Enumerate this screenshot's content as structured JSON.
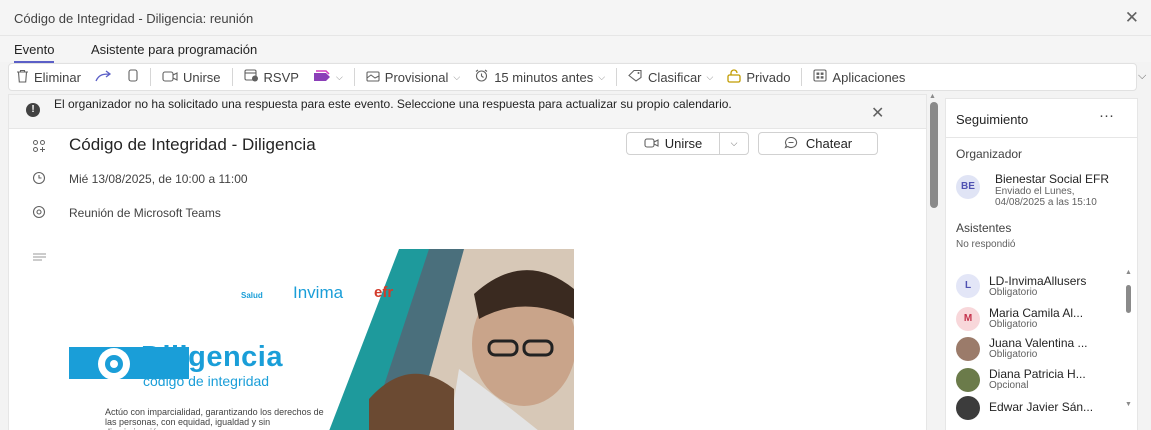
{
  "window": {
    "title": "Código de Integridad - Diligencia: reunión"
  },
  "tabs": [
    {
      "label": "Evento"
    },
    {
      "label": "Asistente para programación"
    }
  ],
  "toolbar": {
    "eliminar": "Eliminar",
    "unirse": "Unirse",
    "rsvp": "RSVP",
    "provisional": "Provisional",
    "reminder": "15 minutos antes",
    "clasificar": "Clasificar",
    "privado": "Privado",
    "aplicaciones": "Aplicaciones"
  },
  "info": {
    "text": "El organizador no ha solicitado una respuesta para este evento. Seleccione una respuesta para actualizar su propio calendario."
  },
  "event": {
    "title": "Código de Integridad - Diligencia",
    "join_label": "Unirse",
    "chat_label": "Chatear",
    "datetime": "Mié 13/08/2025, de 10:00 a 11:00",
    "location": "Reunión de Microsoft Teams"
  },
  "banner": {
    "logo_salud": "Salud",
    "logo_invima": "Invima",
    "logo_efr": "efr",
    "heading": "Diligencia",
    "subheading": "código de integridad",
    "body": "Actúo con imparcialidad, garantizando los derechos de las personas, con equidad, igualdad y sin discriminación."
  },
  "tracking": {
    "title": "Seguimiento",
    "organizer_label": "Organizador",
    "organizer": {
      "initials": "BE",
      "name": "Bienestar Social EFR",
      "sent": "Enviado el Lunes,",
      "sent_date": "04/08/2025 a las 15:10"
    },
    "attendees_label": "Asistentes",
    "no_response": "No respondió",
    "attendees": [
      {
        "initials": "L",
        "name": "LD-InvimaAllusers",
        "role": "Obligatorio",
        "color": "#e3e6f7",
        "text_color": "#4f52b2"
      },
      {
        "initials": "M",
        "name": "Maria Camila Al...",
        "role": "Obligatorio",
        "color": "#f8d7da",
        "text_color": "#c4314b"
      },
      {
        "initials": "",
        "name": "Juana Valentina ...",
        "role": "Obligatorio",
        "color": "#9b7b6a",
        "text_color": "#ffffff"
      },
      {
        "initials": "",
        "name": "Diana Patricia H...",
        "role": "Opcional",
        "color": "#6b7b4a",
        "text_color": "#ffffff"
      },
      {
        "initials": "",
        "name": "Edwar Javier Sán...",
        "role": "",
        "color": "#3c3c3c",
        "text_color": "#ffffff"
      }
    ]
  },
  "colors": {
    "accent": "#5b5fc7",
    "rsvp_icon": "#8b3fb8",
    "privado_icon": "#c19c00",
    "banner_blue": "#1a9ed8",
    "banner_teal": "#1e9a9c"
  }
}
